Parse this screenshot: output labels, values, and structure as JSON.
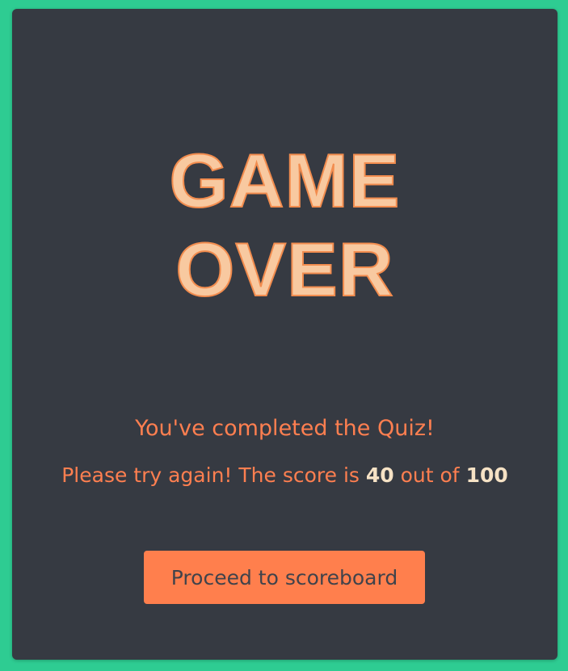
{
  "title": {
    "line1": "GAME",
    "line2": "OVER"
  },
  "message": {
    "completed": "You've completed the Quiz!",
    "score_prefix": "Please try again! The score is",
    "score_value": "40",
    "score_middle": "out of",
    "score_total": "100"
  },
  "actions": {
    "proceed_label": "Proceed to scoreboard"
  },
  "colors": {
    "background": "#2ecc92",
    "card": "#363a42",
    "accent": "#ff7f50",
    "title_fill": "#f8c9a0",
    "score_highlight": "#f6e2c5"
  }
}
